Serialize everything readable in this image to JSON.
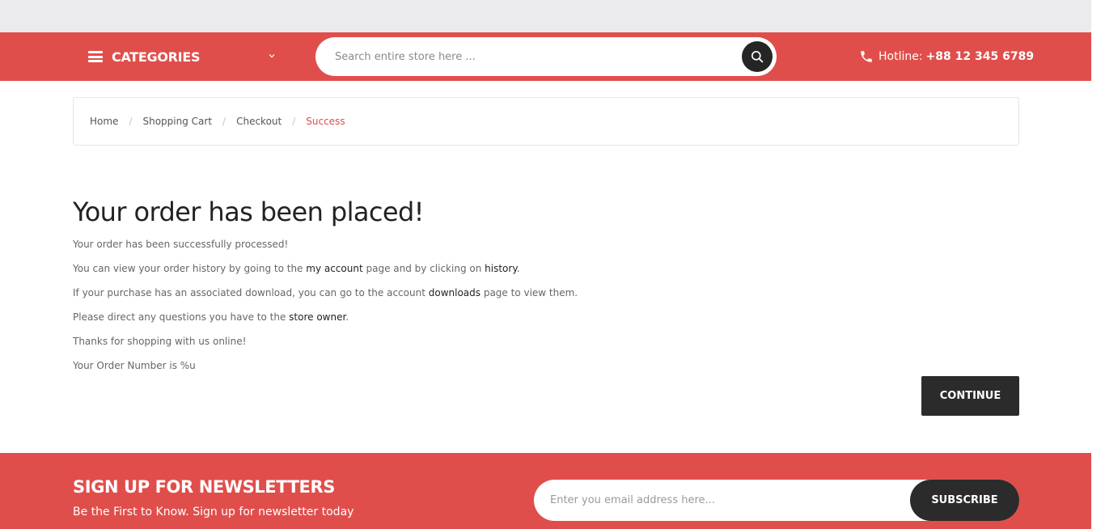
{
  "header": {
    "categories_label": "CATEGORIES",
    "search_placeholder": "Search entire store here ...",
    "hotline_label": "Hotline:",
    "hotline_number": "+88 12 345 6789"
  },
  "breadcrumb": {
    "items": [
      "Home",
      "Shopping Cart",
      "Checkout",
      "Success"
    ],
    "separator": "/"
  },
  "content": {
    "title": "Your order has been placed!",
    "line1": "Your order has been successfully processed!",
    "line2_pre": "You can view your order history by going to the ",
    "line2_link1": "my account",
    "line2_mid": " page and by clicking on ",
    "line2_link2": "history",
    "line2_post": ".",
    "line3_pre": "If your purchase has an associated download, you can go to the account ",
    "line3_link": "downloads",
    "line3_post": " page to view them.",
    "line4_pre": "Please direct any questions you have to the ",
    "line4_link": "store owner",
    "line4_post": ".",
    "line5": "Thanks for shopping with us online!",
    "line6": "Your Order Number is %u",
    "continue_label": "CONTINUE"
  },
  "newsletter": {
    "title": "SIGN UP FOR NEWSLETTERS",
    "subtitle": "Be the First to Know. Sign up for newsletter today",
    "email_placeholder": "Enter you email address here...",
    "subscribe_label": "SUBSCRIBE"
  },
  "colors": {
    "accent": "#e04e4b",
    "dark": "#2b2b2b"
  }
}
